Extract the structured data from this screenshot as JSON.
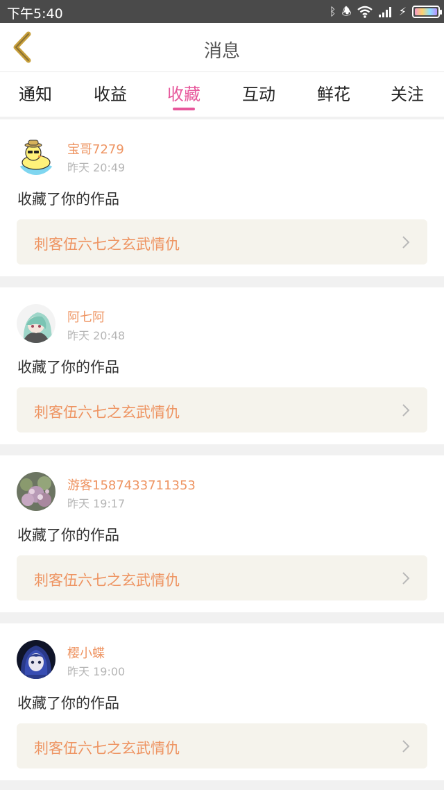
{
  "status_bar": {
    "time": "下午5:40"
  },
  "header": {
    "title": "消息",
    "back_icon": "chevron-left-icon",
    "accent": "#c8a03c"
  },
  "tabs": [
    {
      "label": "通知",
      "active": false
    },
    {
      "label": "收益",
      "active": false
    },
    {
      "label": "收藏",
      "active": true
    },
    {
      "label": "互动",
      "active": false
    },
    {
      "label": "鲜花",
      "active": false
    },
    {
      "label": "关注",
      "active": false
    }
  ],
  "colors": {
    "active_tab": "#e7579b",
    "username": "#ee9462",
    "work_title": "#ee9462",
    "link_bg": "#f5f3ec"
  },
  "messages": [
    {
      "username": "宝哥7279",
      "time": "昨天 20:49",
      "action": "收藏了你的作品",
      "work_title": "刺客伍六七之玄武情仇"
    },
    {
      "username": "阿七阿",
      "time": "昨天 20:48",
      "action": "收藏了你的作品",
      "work_title": "刺客伍六七之玄武情仇"
    },
    {
      "username": "游客1587433711353",
      "time": "昨天 19:17",
      "action": "收藏了你的作品",
      "work_title": "刺客伍六七之玄武情仇"
    },
    {
      "username": "樱小蝶",
      "time": "昨天 19:00",
      "action": "收藏了你的作品",
      "work_title": "刺客伍六七之玄武情仇"
    }
  ]
}
